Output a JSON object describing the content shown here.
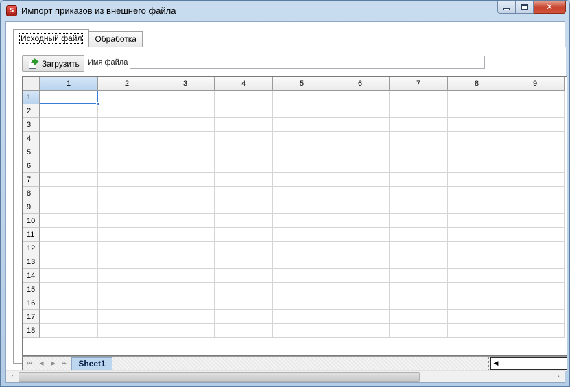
{
  "window": {
    "title": "Импорт приказов из внешнего файла",
    "app_icon_letter": "S",
    "minimize_glyph": "",
    "close_glyph": "✕"
  },
  "tabs": [
    {
      "label": "Исходный файл",
      "active": true
    },
    {
      "label": "Обработка",
      "active": false
    }
  ],
  "toolbar": {
    "load_label": "Загрузить",
    "load_icon": "import-file-icon",
    "file_label": "Имя файла",
    "file_value": ""
  },
  "grid": {
    "columns": [
      "1",
      "2",
      "3",
      "4",
      "5",
      "6",
      "7",
      "8",
      "9"
    ],
    "rows": [
      "1",
      "2",
      "3",
      "4",
      "5",
      "6",
      "7",
      "8",
      "9",
      "10",
      "11",
      "12",
      "13",
      "14",
      "15",
      "16",
      "17",
      "18"
    ],
    "active_cell": "1:1"
  },
  "sheet_bar": {
    "nav": [
      "⏮",
      "◀",
      "▶",
      "⏭"
    ],
    "sheet_name": "Sheet1",
    "scroll_left": "◀"
  },
  "window_scrollbar": {
    "left_arrow": "‹",
    "right_arrow": "›",
    "thumb_fraction": 0.72
  },
  "colors": {
    "accent": "#3a7bd5",
    "selected_header": "#b8d3ee",
    "sheet_tab": "#bcd6f0"
  }
}
